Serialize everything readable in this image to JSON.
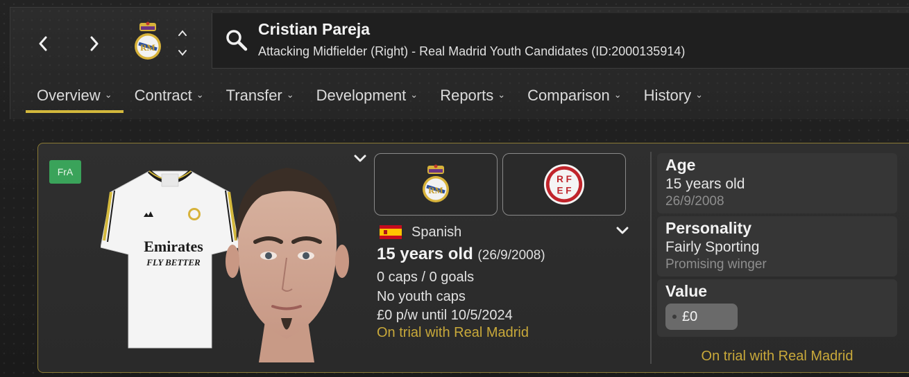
{
  "header": {
    "player_name": "Cristian Pareja",
    "player_subtitle": "Attacking Midfielder (Right) - Real Madrid Youth Candidates (ID:2000135914)",
    "back_icon": "chevron-left-icon",
    "forward_icon": "chevron-right-icon",
    "search_icon": "search-icon"
  },
  "tabs": [
    {
      "label": "Overview",
      "active": true
    },
    {
      "label": "Contract",
      "active": false
    },
    {
      "label": "Transfer",
      "active": false
    },
    {
      "label": "Development",
      "active": false
    },
    {
      "label": "Reports",
      "active": false
    },
    {
      "label": "Comparison",
      "active": false
    },
    {
      "label": "History",
      "active": false
    }
  ],
  "profile": {
    "role_badge": "FrA",
    "shirt_sponsor_line1": "Emirates",
    "shirt_sponsor_line2": "FLY BETTER",
    "federation_logo_text": [
      "R F",
      "E F"
    ],
    "nationality": "Spanish",
    "age_text": "15 years old",
    "dob_text": "(26/9/2008)",
    "caps_text": "0 caps / 0 goals",
    "youth_caps_text": "No youth caps",
    "wage_text": "£0 p/w until 10/5/2024",
    "trial_text": "On trial with Real Madrid"
  },
  "side": {
    "age_title": "Age",
    "age_value": "15 years old",
    "age_dob": "26/9/2008",
    "personality_title": "Personality",
    "personality_value": "Fairly Sporting",
    "personality_sub": "Promising winger",
    "value_title": "Value",
    "value_amount": "£0",
    "trial_text": "On trial with Real Madrid"
  },
  "colors": {
    "accent_gold": "#d4b93c",
    "trial_gold": "#c9a93a",
    "badge_green": "#3aa35a",
    "card_border": "#8c7c35"
  }
}
